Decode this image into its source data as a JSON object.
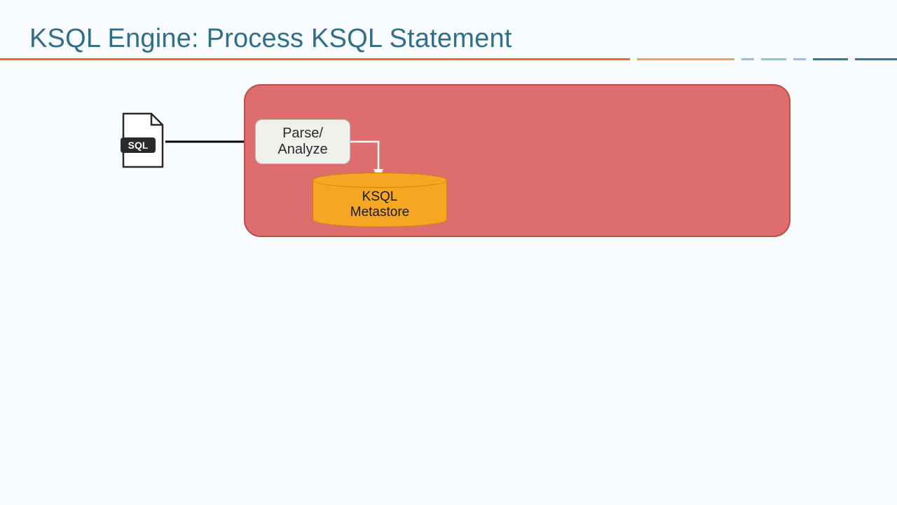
{
  "title": "KSQL Engine: Process KSQL Statement",
  "sql_icon_label": "SQL",
  "parse_node": {
    "line1": "Parse/",
    "line2": "Analyze"
  },
  "metastore": {
    "line1": "KSQL",
    "line2": "Metastore"
  },
  "colors": {
    "engine_fill": "#de6e6d",
    "engine_border": "#c24a49",
    "metastore_fill": "#f5a623",
    "title": "#2f6f87"
  }
}
